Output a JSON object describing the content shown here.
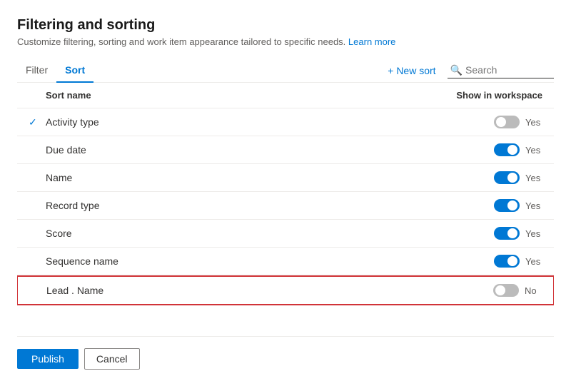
{
  "page": {
    "title": "Filtering and sorting",
    "subtitle": "Customize filtering, sorting and work item appearance tailored to specific needs.",
    "learn_more": "Learn more"
  },
  "tabs": [
    {
      "id": "filter",
      "label": "Filter",
      "active": false
    },
    {
      "id": "sort",
      "label": "Sort",
      "active": true
    }
  ],
  "toolbar": {
    "new_sort_label": "+ New sort",
    "search_placeholder": "Search"
  },
  "table": {
    "col_sort_name": "Sort name",
    "col_show": "Show in workspace",
    "rows": [
      {
        "name": "Activity type",
        "checked": true,
        "toggle": "off",
        "show_label": "Yes"
      },
      {
        "name": "Due date",
        "checked": false,
        "toggle": "on",
        "show_label": "Yes"
      },
      {
        "name": "Name",
        "checked": false,
        "toggle": "on",
        "show_label": "Yes"
      },
      {
        "name": "Record type",
        "checked": false,
        "toggle": "on",
        "show_label": "Yes"
      },
      {
        "name": "Score",
        "checked": false,
        "toggle": "on",
        "show_label": "Yes"
      },
      {
        "name": "Sequence name",
        "checked": false,
        "toggle": "on",
        "show_label": "Yes"
      },
      {
        "name": "Lead . Name",
        "checked": false,
        "toggle": "off",
        "show_label": "No",
        "selected": true
      }
    ]
  },
  "footer": {
    "publish_label": "Publish",
    "cancel_label": "Cancel"
  }
}
